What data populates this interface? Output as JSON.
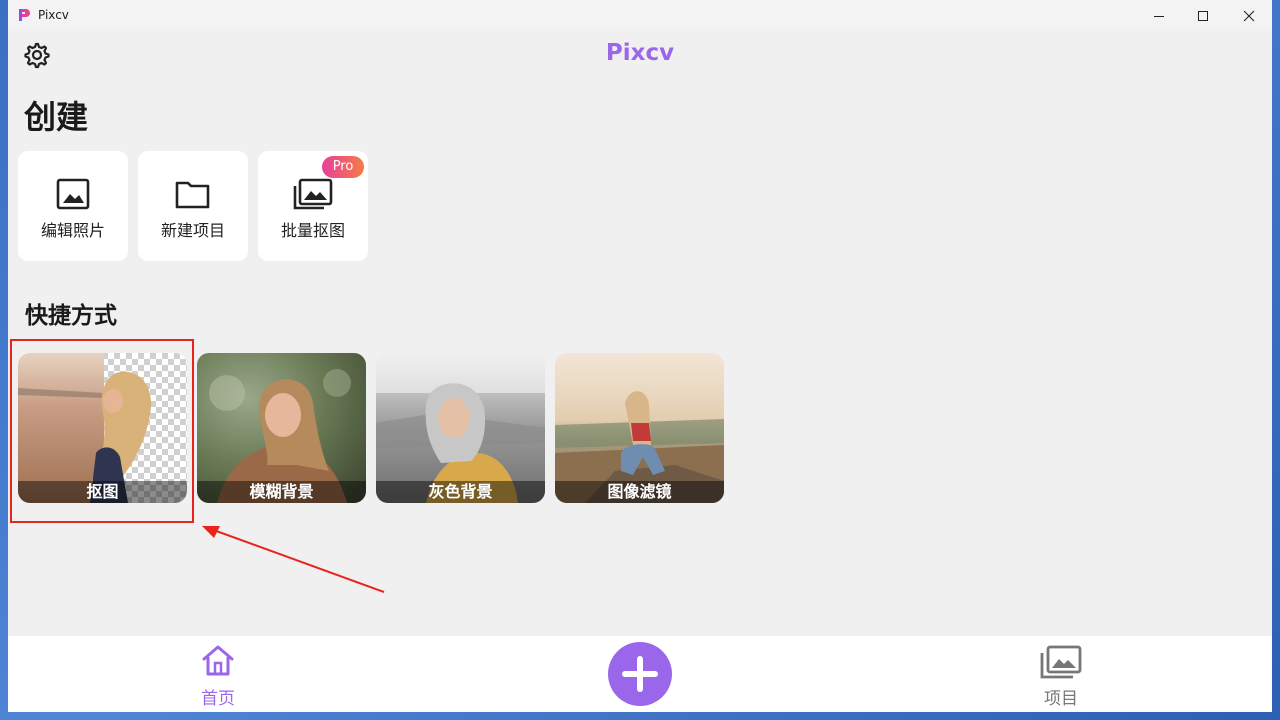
{
  "window": {
    "title": "Pixcv",
    "controls": [
      "minimize",
      "maximize",
      "close"
    ]
  },
  "header": {
    "app_name": "Pixcv",
    "settings_icon": "gear-icon"
  },
  "create_section": {
    "heading": "创建",
    "cards": [
      {
        "label": "编辑照片",
        "icon": "image-icon"
      },
      {
        "label": "新建项目",
        "icon": "folder-icon"
      },
      {
        "label": "批量抠图",
        "icon": "images-stack-icon",
        "badge": "Pro"
      }
    ]
  },
  "shortcuts_section": {
    "heading": "快捷方式",
    "tiles": [
      {
        "label": "抠图"
      },
      {
        "label": "模糊背景"
      },
      {
        "label": "灰色背景"
      },
      {
        "label": "图像滤镜"
      }
    ]
  },
  "bottom_nav": {
    "home_label": "首页",
    "projects_label": "项目",
    "add_icon": "plus-icon"
  },
  "colors": {
    "accent": "#9b67ea",
    "highlight": "#e8231c",
    "pro_gradient_start": "#e8409a",
    "pro_gradient_end": "#f47b45"
  }
}
